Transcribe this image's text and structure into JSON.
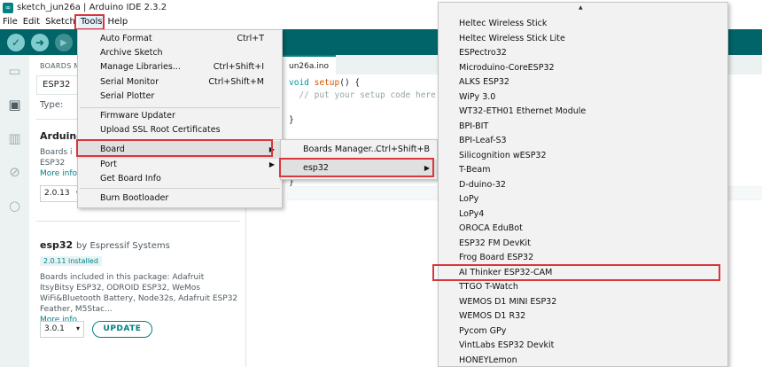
{
  "window": {
    "title": "sketch_jun26a | Arduino IDE 2.3.2"
  },
  "menubar": [
    "File",
    "Edit",
    "Sketch",
    "Tools",
    "Help"
  ],
  "toolbar": {
    "verify_icon": "check-icon",
    "upload_icon": "arrow-right-icon",
    "debug_icon": "debug-icon"
  },
  "sidebar": {
    "icons": [
      "folder-icon",
      "boards-icon",
      "library-icon",
      "debug-icon",
      "search-icon"
    ]
  },
  "boards_panel": {
    "title": "BOARDS M",
    "search_value": "ESP32",
    "type_label": "Type:",
    "card1": {
      "name": "Arduino",
      "desc_line1": "Boards i",
      "desc_line2": "ESP32",
      "more": "More info",
      "version": "2.0.13"
    },
    "card2": {
      "name": "esp32",
      "by": "by Espressif Systems",
      "installed": "2.0.11 installed",
      "desc": "Boards included in this package: Adafruit ItsyBitsy ESP32, ODROID ESP32, WeMos WiFi&Bluetooth Battery, Node32s, Adafruit ESP32 Feather, M5Stac...",
      "more": "More info",
      "version": "3.0.1",
      "update_label": "UPDATE"
    }
  },
  "editor": {
    "tab_label": "un26a.ino",
    "code": [
      "void setup() {",
      "  // put your setup code here",
      "",
      "}",
      "",
      "",
      "",
      "",
      "",
      "}"
    ]
  },
  "tools_menu": {
    "items": [
      {
        "label": "Auto Format",
        "shortcut": "Ctrl+T"
      },
      {
        "label": "Archive Sketch",
        "shortcut": ""
      },
      {
        "label": "Manage Libraries...",
        "shortcut": "Ctrl+Shift+I"
      },
      {
        "label": "Serial Monitor",
        "shortcut": "Ctrl+Shift+M"
      },
      {
        "label": "Serial Plotter",
        "shortcut": ""
      },
      {
        "label": "Firmware Updater",
        "shortcut": ""
      },
      {
        "label": "Upload SSL Root Certificates",
        "shortcut": ""
      },
      {
        "label": "Board",
        "shortcut": ""
      },
      {
        "label": "Port",
        "shortcut": ""
      },
      {
        "label": "Get Board Info",
        "shortcut": ""
      },
      {
        "label": "Burn Bootloader",
        "shortcut": ""
      }
    ]
  },
  "board_submenu": {
    "items": [
      {
        "label": "Boards Manager...",
        "shortcut": "Ctrl+Shift+B"
      },
      {
        "label": "esp32",
        "shortcut": ""
      }
    ]
  },
  "esp32_boards": [
    "Heltec Wireless Stick",
    "Heltec Wireless Stick Lite",
    "ESPectro32",
    "Microduino-CoreESP32",
    "ALKS ESP32",
    "WiPy 3.0",
    "WT32-ETH01 Ethernet Module",
    "BPI-BIT",
    "BPI-Leaf-S3",
    "Silicognition wESP32",
    "T-Beam",
    "D-duino-32",
    "LoPy",
    "LoPy4",
    "OROCA EduBot",
    "ESP32 FM DevKit",
    "Frog Board ESP32",
    "AI Thinker ESP32-CAM",
    "TTGO T-Watch",
    "WEMOS D1 MINI ESP32",
    "WEMOS D1 R32",
    "Pycom GPy",
    "VintLabs ESP32 Devkit",
    "HONEYLemon"
  ],
  "colors": {
    "accent": "#008184",
    "toolbar": "#006468",
    "highlight_box": "#d9363e"
  }
}
